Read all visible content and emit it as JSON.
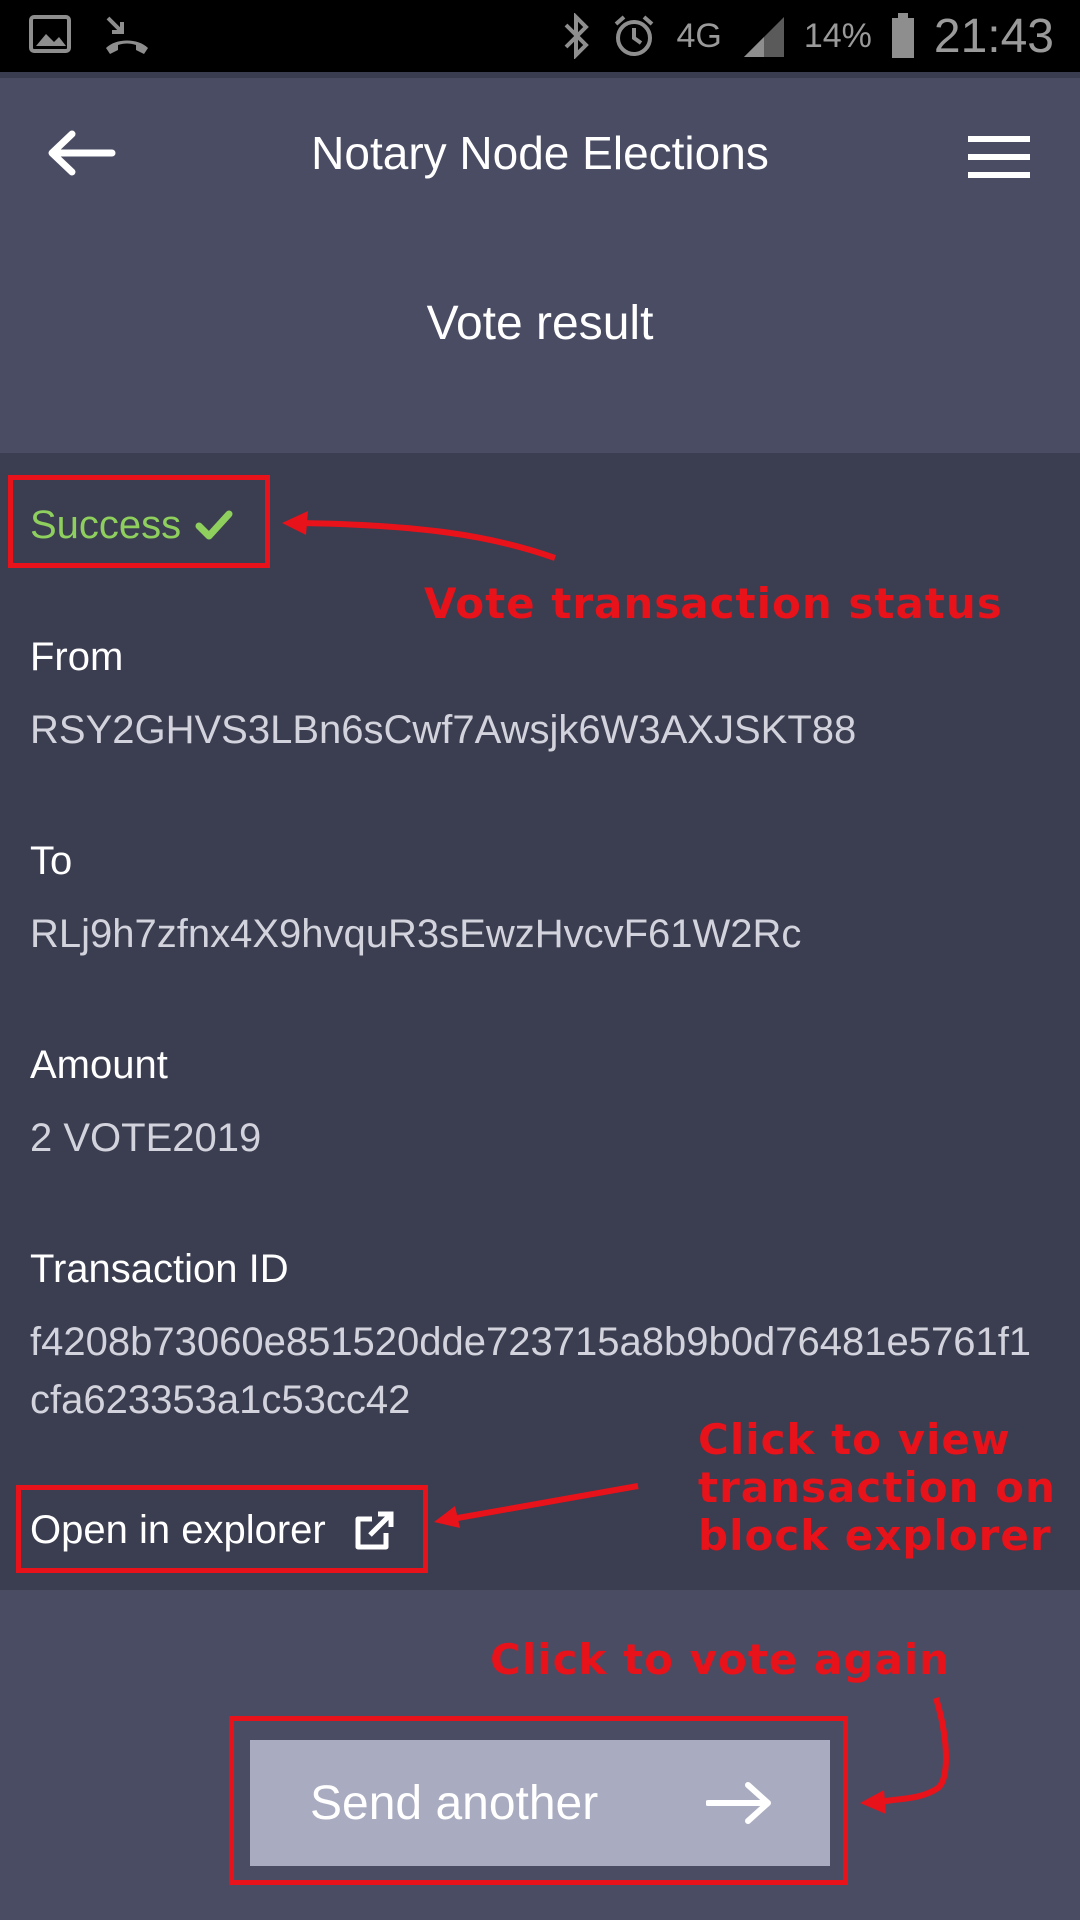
{
  "status_bar": {
    "battery": "14%",
    "time": "21:43",
    "network": "4G",
    "icons": [
      "gallery-icon",
      "missed-call-icon",
      "bluetooth-icon",
      "alarm-icon",
      "signal-icon",
      "battery-icon"
    ]
  },
  "app_bar": {
    "title": "Notary Node Elections",
    "back_icon": "arrow-left-icon",
    "menu_icon": "hamburger-menu-icon"
  },
  "section": {
    "heading": "Vote result"
  },
  "result": {
    "status": "Success",
    "status_color": "#8ecf5e",
    "fields": [
      {
        "label": "From",
        "value": "RSY2GHVS3LBn6sCwf7Awsjk6W3AXJSKT88"
      },
      {
        "label": "To",
        "value": "RLj9h7zfnx4X9hvquR3sEwzHvcvF61W2Rc"
      },
      {
        "label": "Amount",
        "value": "2 VOTE2019"
      },
      {
        "label": "Transaction ID",
        "value": "f4208b73060e851520dde723715a8b9b0d76481e5761f1cfa623353a1c53cc42"
      }
    ],
    "explorer_link": "Open in explorer"
  },
  "footer": {
    "send_button": "Send another"
  },
  "annotations": {
    "status_note": "Vote transaction status",
    "explorer_note_lines": [
      "Click to view",
      "transaction on",
      "block explorer"
    ],
    "send_note": "Click to vote again",
    "color": "#e8121a"
  }
}
